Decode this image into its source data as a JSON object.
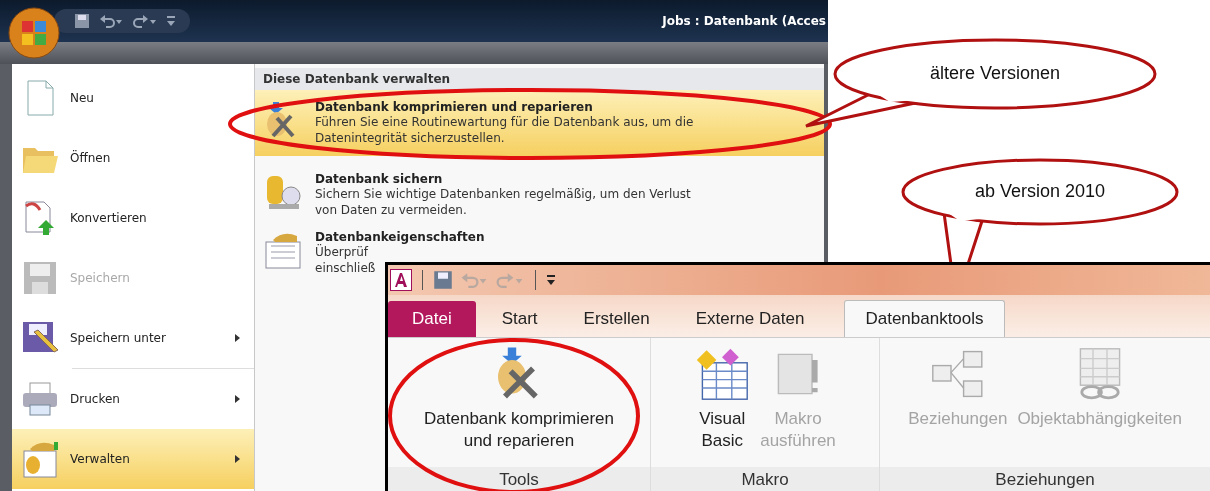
{
  "old_window": {
    "title": "Jobs : Datenbank (Acces",
    "menu": [
      {
        "label": "Neu",
        "disabled": false,
        "submenu": false,
        "selected": false
      },
      {
        "label": "Öffnen",
        "disabled": false,
        "submenu": false,
        "selected": false
      },
      {
        "label": "Konvertieren",
        "disabled": false,
        "submenu": false,
        "selected": false
      },
      {
        "label": "Speichern",
        "disabled": true,
        "submenu": false,
        "selected": false
      },
      {
        "label": "Speichern unter",
        "disabled": false,
        "submenu": true,
        "selected": false
      },
      {
        "label": "Drucken",
        "disabled": false,
        "submenu": true,
        "selected": false
      },
      {
        "label": "Verwalten",
        "disabled": false,
        "submenu": true,
        "selected": true
      }
    ],
    "panel": {
      "heading": "Diese Datenbank verwalten",
      "items": [
        {
          "title": "Datenbank komprimieren und reparieren",
          "description": "Führen Sie eine Routinewartung für die Datenbank aus, um die\nDatenintegrität sicherzustellen.",
          "selected": true
        },
        {
          "title": "Datenbank sichern",
          "description": "Sichern Sie wichtige Datenbanken regelmäßig, um den Verlust\nvon Daten zu vermeiden.",
          "selected": false
        },
        {
          "title": "Datenbankeigenschaften",
          "description": "Überprüf\neinschließ",
          "selected": false
        }
      ]
    }
  },
  "new_window": {
    "tabs": [
      {
        "label": "Datei",
        "kind": "file",
        "selected": false
      },
      {
        "label": "Start",
        "kind": "tab",
        "selected": false
      },
      {
        "label": "Erstellen",
        "kind": "tab",
        "selected": false
      },
      {
        "label": "Externe Daten",
        "kind": "tab",
        "selected": false
      },
      {
        "label": "Datenbanktools",
        "kind": "tab",
        "selected": true
      }
    ],
    "groups": [
      {
        "label": "Tools",
        "buttons": [
          {
            "label": "Datenbank komprimieren\nund reparieren",
            "disabled": false
          }
        ]
      },
      {
        "label": "Makro",
        "buttons": [
          {
            "label": "Visual\nBasic",
            "disabled": false
          },
          {
            "label": "Makro\nausführen",
            "disabled": true
          }
        ]
      },
      {
        "label": "Beziehungen",
        "buttons": [
          {
            "label": "Beziehungen",
            "disabled": true
          },
          {
            "label": "Objektabhängigkeiten",
            "disabled": true
          }
        ]
      }
    ]
  },
  "callouts": [
    {
      "text": "ältere Versionen"
    },
    {
      "text": "ab Version 2010"
    }
  ]
}
